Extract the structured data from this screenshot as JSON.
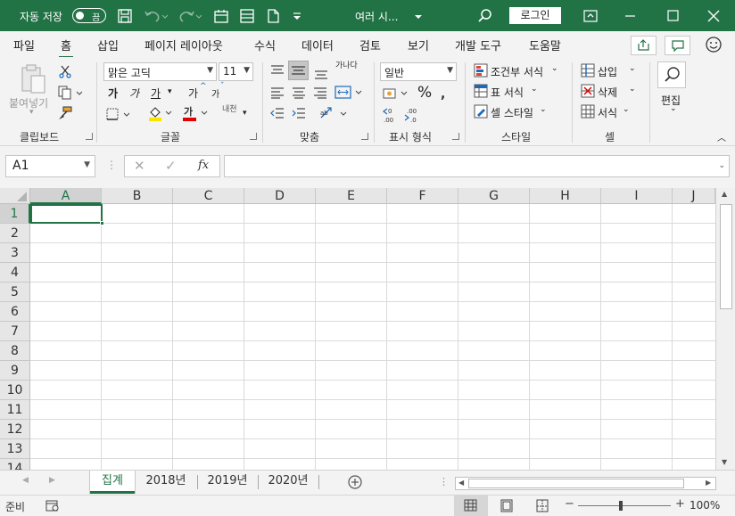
{
  "titlebar": {
    "autosave_label": "자동 저장",
    "autosave_state": "끔",
    "doc_title": "여러 시...",
    "login_label": "로그인"
  },
  "menu": {
    "tabs": [
      "파일",
      "홈",
      "삽입",
      "페이지 레이아웃",
      "수식",
      "데이터",
      "검토",
      "보기",
      "개발 도구",
      "도움말"
    ],
    "active": "홈"
  },
  "ribbon": {
    "clipboard": {
      "paste_label": "붙여넣기",
      "group_label": "클립보드"
    },
    "font": {
      "font_name": "맑은 고딕",
      "font_size": "11",
      "bold": "가",
      "italic": "가",
      "underline": "가",
      "grow": "가",
      "shrink": "가",
      "phonetic": "내천",
      "group_label": "글꼴"
    },
    "alignment": {
      "group_label": "맞춤",
      "wrap_label": "가나다"
    },
    "number": {
      "format": "일반",
      "percent": "%",
      "group_label": "표시 형식",
      "inc_decimal": ".00",
      "dec_decimal": ".0"
    },
    "styles": {
      "conditional": "조건부 서식",
      "table": "표 서식",
      "cell_styles": "셀 스타일",
      "group_label": "스타일"
    },
    "cells": {
      "insert": "삽입",
      "delete": "삭제",
      "format": "서식",
      "group_label": "셀"
    },
    "editing": {
      "label": "편집"
    }
  },
  "formula_bar": {
    "name_box": "A1",
    "fx": "fx",
    "formula": ""
  },
  "grid": {
    "columns": [
      "A",
      "B",
      "C",
      "D",
      "E",
      "F",
      "G",
      "H",
      "I",
      "J"
    ],
    "rows": [
      "1",
      "2",
      "3",
      "4",
      "5",
      "6",
      "7",
      "8",
      "9",
      "10",
      "11",
      "12",
      "13",
      "14"
    ],
    "selected_cell": "A1"
  },
  "sheets": {
    "tabs": [
      "집계",
      "2018년",
      "2019년",
      "2020년"
    ],
    "active": "집계"
  },
  "status": {
    "ready": "준비",
    "zoom": "100%"
  },
  "colors": {
    "accent": "#217346",
    "ribbon_bg": "#f3f3f3"
  }
}
